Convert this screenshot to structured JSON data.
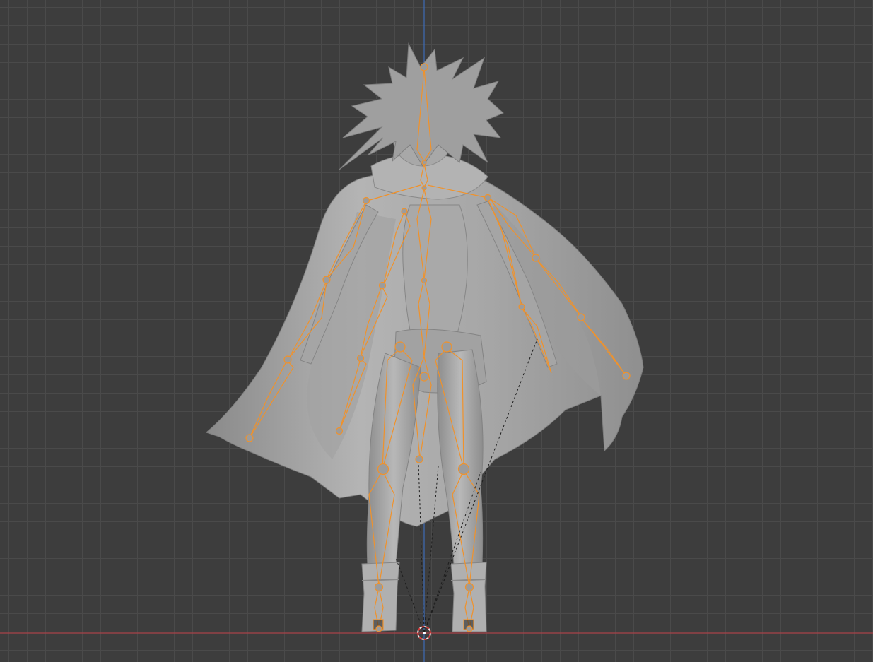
{
  "viewport": {
    "mode": "Pose / Armature",
    "axes": {
      "x_axis_color": "#b3424a",
      "z_axis_color": "#3b6ab8"
    },
    "grid_color": "#4b4b4b",
    "background_color": "#3d3d3d",
    "selection_color": "#f0922b",
    "mesh_color": "#9a9a9a"
  },
  "icons": {
    "origin": "3d-cursor-icon",
    "armature": "armature-icon"
  }
}
